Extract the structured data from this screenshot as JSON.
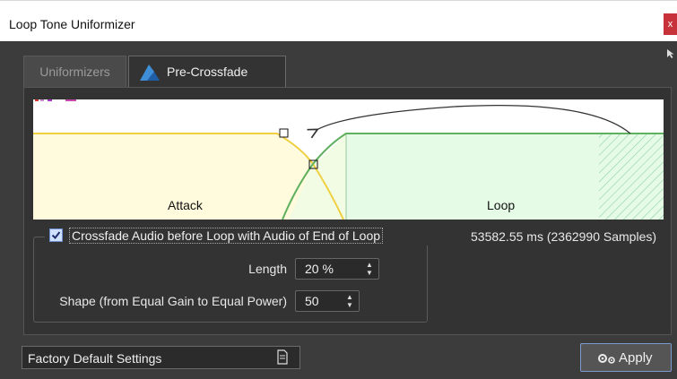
{
  "window": {
    "title": "Loop Tone Uniformizer",
    "close_glyph": "x"
  },
  "tabs": [
    {
      "label": "Uniformizers",
      "active": false
    },
    {
      "label": "Pre-Crossfade",
      "active": true,
      "icon": "crossfade-icon"
    }
  ],
  "graph": {
    "attack_label": "Attack",
    "loop_label": "Loop",
    "colors": {
      "attack_fill": "#fffbdc",
      "attack_curve": "#f0d040",
      "loop_fill": "#e6fbe6",
      "loop_curve": "#5fb15f"
    }
  },
  "crossfade": {
    "checkbox_label": "Crossfade Audio before Loop with Audio of End of Loop",
    "checked": true,
    "duration_text": "53582.55 ms (2362990 Samples)",
    "length_label": "Length",
    "length_value": "20 %",
    "shape_label": "Shape (from Equal Gain to Equal Power)",
    "shape_value": "50"
  },
  "footer": {
    "preset_text": "Factory Default Settings",
    "apply_label": "Apply"
  },
  "icons": {
    "spin_up": "▲",
    "spin_down": "▼"
  }
}
